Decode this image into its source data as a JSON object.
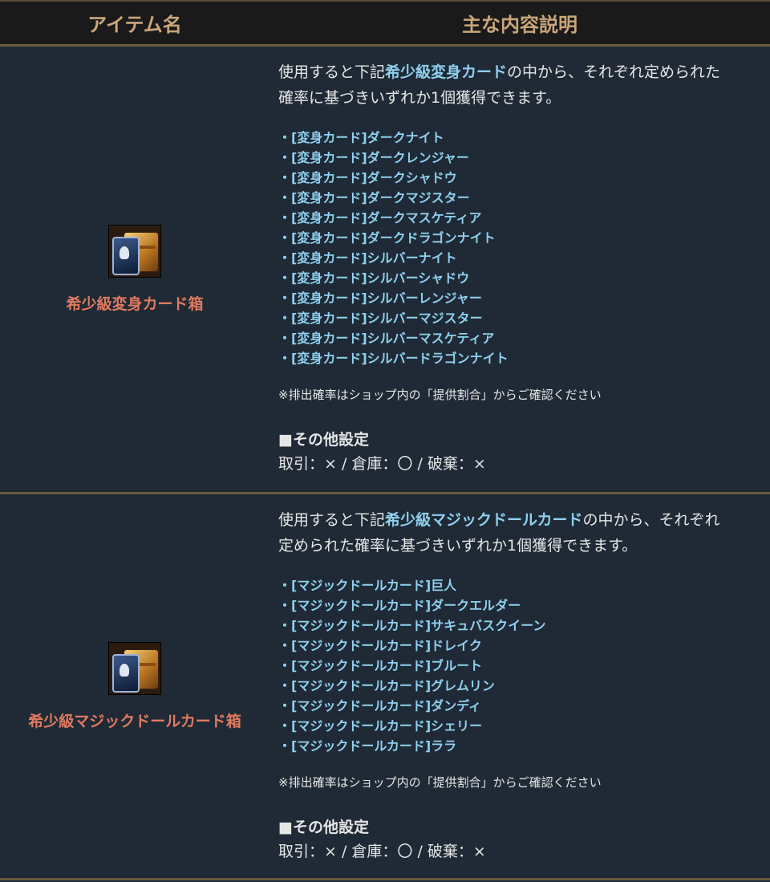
{
  "header": {
    "col1": "アイテム名",
    "col2": "主な内容説明"
  },
  "items": [
    {
      "name": "希少級変身カード箱",
      "icon": "card-chest-icon",
      "desc_pre": "使用すると下記",
      "desc_highlight": "希少級変身カード",
      "desc_post1": "の中から、それぞれ定められた",
      "desc_line2": "確率に基づきいずれか1個獲得できます。",
      "list": [
        "・[変身カード]ダークナイト",
        "・[変身カード]ダークレンジャー",
        "・[変身カード]ダークシャドウ",
        "・[変身カード]ダークマジスター",
        "・[変身カード]ダークマスケティア",
        "・[変身カード]ダークドラゴンナイト",
        "・[変身カード]シルバーナイト",
        "・[変身カード]シルバーシャドウ",
        "・[変身カード]シルバーレンジャー",
        "・[変身カード]シルバーマジスター",
        "・[変身カード]シルバーマスケティア",
        "・[変身カード]シルバードラゴンナイト"
      ],
      "note": "※排出確率はショップ内の「提供割合」からご確認ください",
      "settings_title": "■その他設定",
      "settings_values": "取引：× / 倉庫：〇 / 破棄：×"
    },
    {
      "name": "希少級マジックドールカード箱",
      "icon": "card-chest-icon",
      "desc_pre": "使用すると下記",
      "desc_highlight": "希少級マジックドールカード",
      "desc_post1": "の中から、それぞれ",
      "desc_line2": "定められた確率に基づきいずれか1個獲得できます。",
      "list": [
        "・[マジックドールカード]巨人",
        "・[マジックドールカード]ダークエルダー",
        "・[マジックドールカード]サキュバスクイーン",
        "・[マジックドールカード]ドレイク",
        "・[マジックドールカード]ブルート",
        "・[マジックドールカード]グレムリン",
        "・[マジックドールカード]ダンディ",
        "・[マジックドールカード]シェリー",
        "・[マジックドールカード]ララ"
      ],
      "note": "※排出確率はショップ内の「提供割合」からご確認ください",
      "settings_title": "■その他設定",
      "settings_values": "取引：× / 倉庫：〇 / 破棄：×"
    }
  ]
}
